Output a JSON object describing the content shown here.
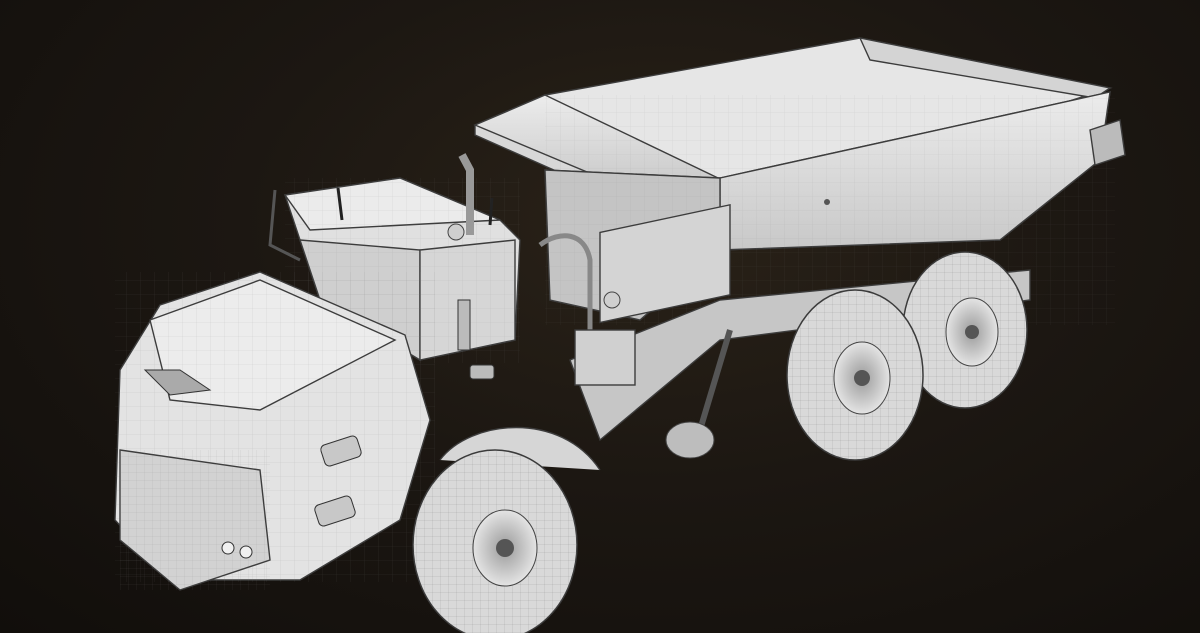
{
  "image": {
    "subject": "",
    "colors": {
      "background_center": "#2a2218",
      "background_edge": "#110e0b",
      "model_surface": "#dcdcdc",
      "model_shadow": "#b4b4b4",
      "wireframe": "#6e6e6e"
    }
  }
}
